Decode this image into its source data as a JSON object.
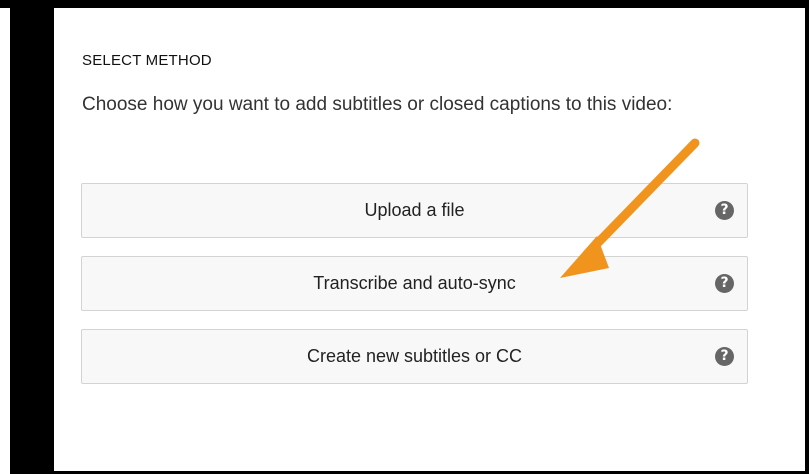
{
  "section_title": "SELECT METHOD",
  "instructions": "Choose how you want to add subtitles or closed captions to this video:",
  "methods": [
    {
      "label": "Upload a file",
      "help_icon": "?"
    },
    {
      "label": "Transcribe and auto-sync",
      "help_icon": "?"
    },
    {
      "label": "Create new subtitles or CC",
      "help_icon": "?"
    }
  ],
  "colors": {
    "arrow": "#f0941e",
    "button_bg": "#f8f8f8",
    "button_border": "#d3d3d3",
    "help_icon_bg": "#666666"
  }
}
